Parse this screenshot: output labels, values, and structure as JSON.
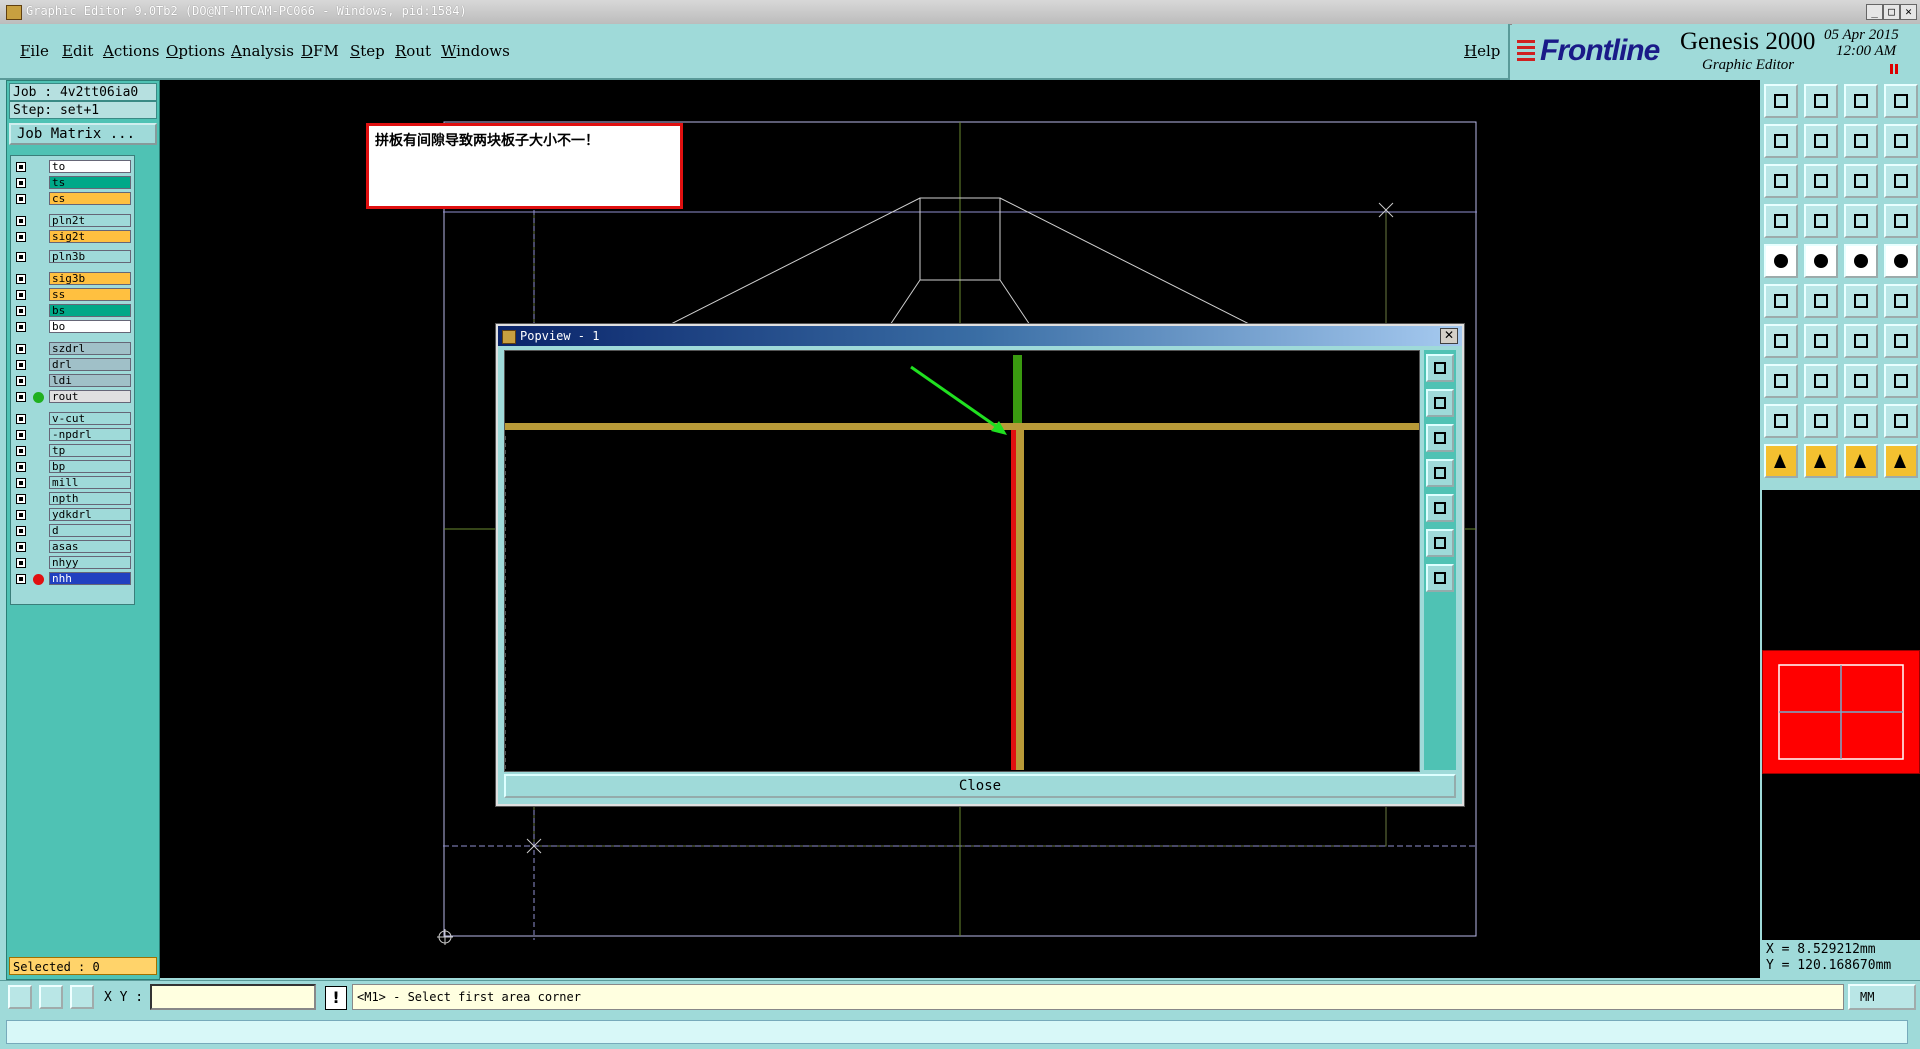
{
  "window": {
    "title": "Graphic Editor 9.0Tb2 (DO@NT-MTCAM-PC066 - Windows, pid:1584)"
  },
  "menu": {
    "items": [
      "File",
      "Edit",
      "Actions",
      "Options",
      "Analysis",
      "DFM",
      "Step",
      "Rout",
      "Windows"
    ],
    "help": "Help"
  },
  "brand": {
    "logo": "Frontline",
    "product": "Genesis 2000",
    "subtitle": "Graphic Editor",
    "date": "05 Apr 2015",
    "time": "12:00 AM"
  },
  "job": {
    "job_line": "Job : 4v2tt06ia0",
    "step_line": "Step: set+1",
    "job_matrix": "Job Matrix ...",
    "selected": "Selected : 0"
  },
  "layers": [
    {
      "name": "to",
      "color": "#ffffff"
    },
    {
      "name": "ts",
      "color": "#00a888"
    },
    {
      "name": "cs",
      "color": "#ffc040"
    },
    {
      "name": "pln2t",
      "color": "#9fdad9"
    },
    {
      "name": "sig2t",
      "color": "#ffc040"
    },
    {
      "name": "pln3b",
      "color": "#9fdad9"
    },
    {
      "name": "sig3b",
      "color": "#ffc040"
    },
    {
      "name": "ss",
      "color": "#ffc040"
    },
    {
      "name": "bs",
      "color": "#00a888"
    },
    {
      "name": "bo",
      "color": "#ffffff"
    },
    {
      "name": "szdrl",
      "color": "#a0c0c8"
    },
    {
      "name": "drl",
      "color": "#a0c0c8"
    },
    {
      "name": "ldi",
      "color": "#a0c0c8"
    },
    {
      "name": "rout",
      "color": "#e0e0e0",
      "dot": "#20b020"
    },
    {
      "name": "v-cut",
      "color": "#9fdad9"
    },
    {
      "name": "-npdrl",
      "color": "#9fdad9"
    },
    {
      "name": "tp",
      "color": "#9fdad9"
    },
    {
      "name": "bp",
      "color": "#9fdad9"
    },
    {
      "name": "mill",
      "color": "#9fdad9"
    },
    {
      "name": "npth",
      "color": "#9fdad9"
    },
    {
      "name": "ydkdrl",
      "color": "#9fdad9"
    },
    {
      "name": "d",
      "color": "#9fdad9"
    },
    {
      "name": "asas",
      "color": "#9fdad9"
    },
    {
      "name": "nhyy",
      "color": "#9fdad9"
    },
    {
      "name": "nhh",
      "color": "#2040c0",
      "dot": "#e01010",
      "active": true
    }
  ],
  "note": {
    "text": "拼板有间隙导致两块板子大小不一！"
  },
  "popview": {
    "title": "Popview - 1",
    "close_label": "Close",
    "close_x": "✕"
  },
  "coords": {
    "x": "X = 8.529212mm",
    "y": "Y = 120.168670mm"
  },
  "bottom": {
    "xy_label": "X Y :",
    "xy_value": "",
    "excl": "!",
    "status": "<M1> - Select first area corner",
    "unit": "MM"
  }
}
